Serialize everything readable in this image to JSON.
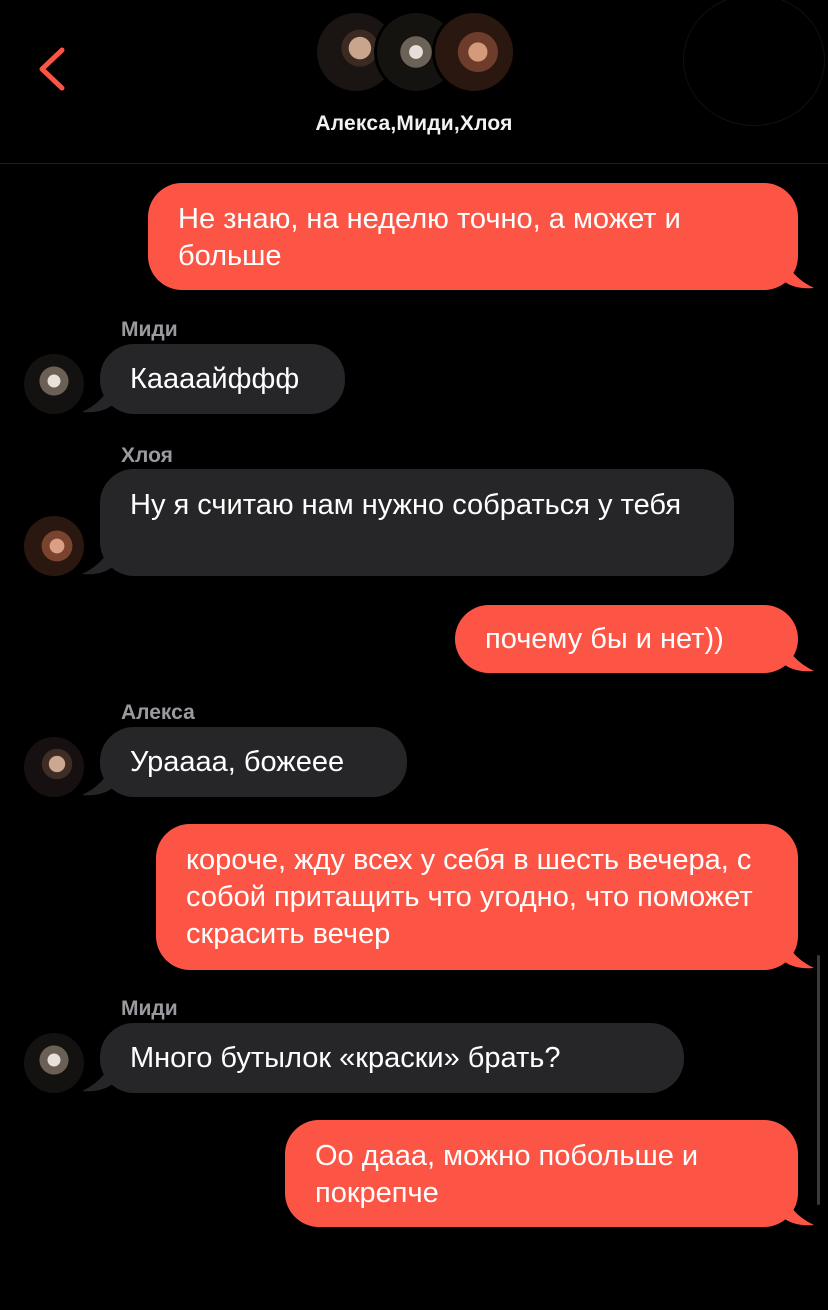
{
  "header": {
    "title": "Алекса,Миди,Хлоя",
    "back_icon": "chevron-left-icon",
    "accent_color": "#fd5545"
  },
  "colors": {
    "outgoing_bubble": "#fd5545",
    "incoming_bubble": "#262629",
    "sender_name": "#9a9a9e",
    "background": "#000000"
  },
  "messages": [
    {
      "direction": "out",
      "text": "Не знаю, на неделю точно, а может и больше"
    },
    {
      "direction": "in",
      "sender": "Миди",
      "text": "Каааайффф"
    },
    {
      "direction": "in",
      "sender": "Хлоя",
      "text": "Ну я считаю нам нужно собраться у тебя"
    },
    {
      "direction": "out",
      "text": "почему бы и нет))"
    },
    {
      "direction": "in",
      "sender": "Алекса",
      "text": "Ураааа, божеее"
    },
    {
      "direction": "out",
      "text": "короче, жду всех у себя в шесть вечера, с собой притащить что угодно, что поможет скрасить вечер"
    },
    {
      "direction": "in",
      "sender": "Миди",
      "text": "Много бутылок «краски» брать?"
    },
    {
      "direction": "out",
      "text": "Оо дааа, можно побольше и покрепче"
    }
  ]
}
